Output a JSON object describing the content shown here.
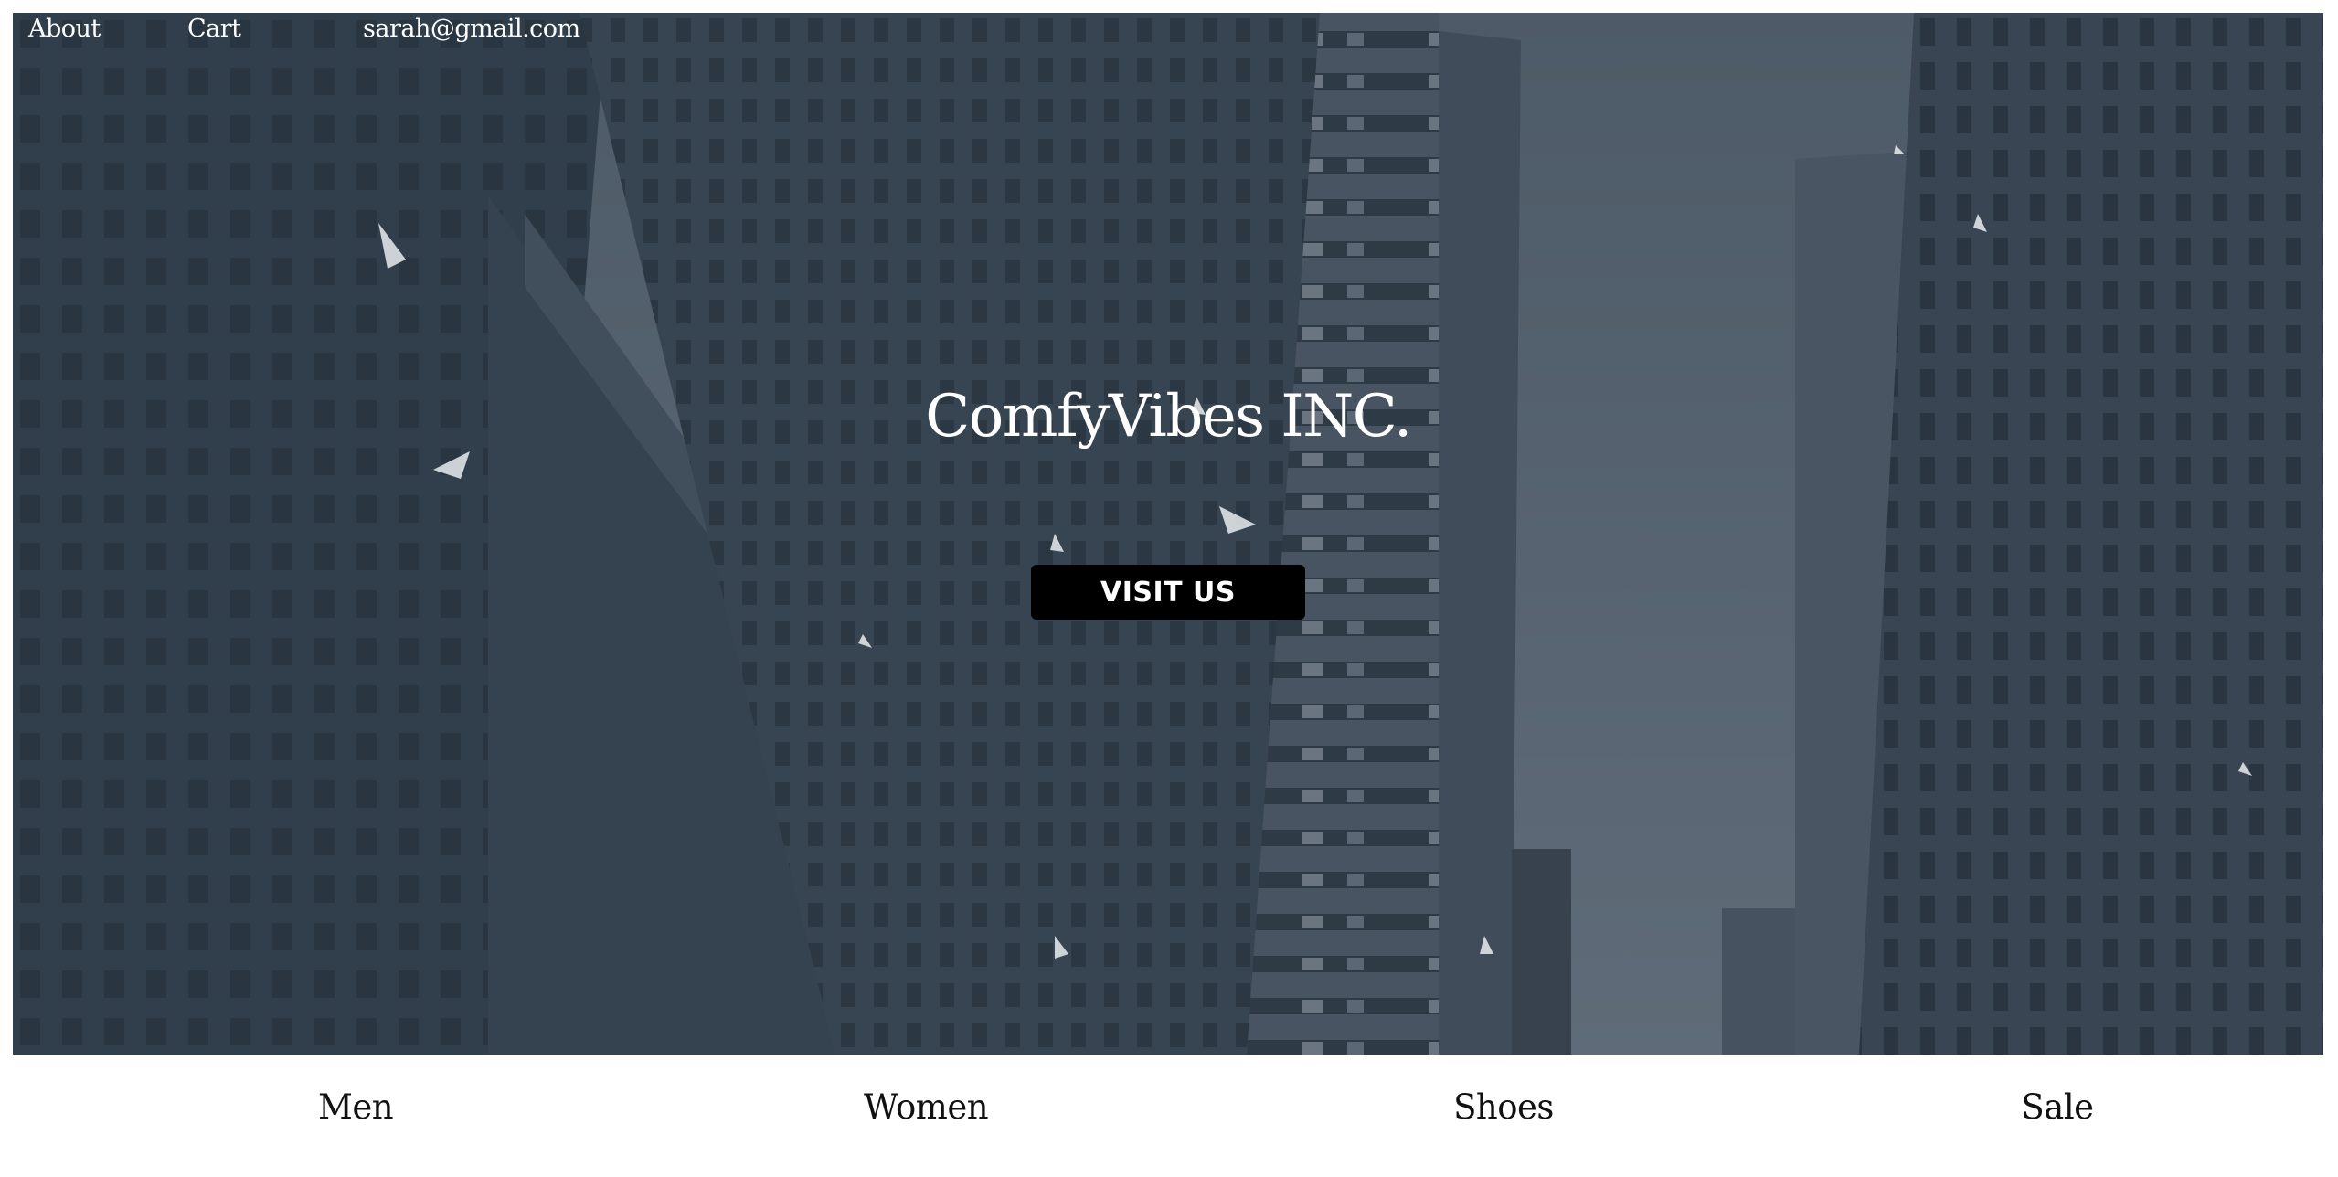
{
  "nav": {
    "about": "About",
    "cart": "Cart",
    "email": "sarah@gmail.com"
  },
  "hero": {
    "title": "ComfyVibes INC.",
    "button_label": "VISIT US",
    "background": "city-skyscrapers-photo"
  },
  "categories": [
    "Men",
    "Women",
    "Shoes",
    "Sale"
  ],
  "colors": {
    "overlay": "#3b4856",
    "sky": "#6b7785",
    "button": "#000000",
    "text_light": "#ffffff",
    "text_dark": "#111111"
  }
}
